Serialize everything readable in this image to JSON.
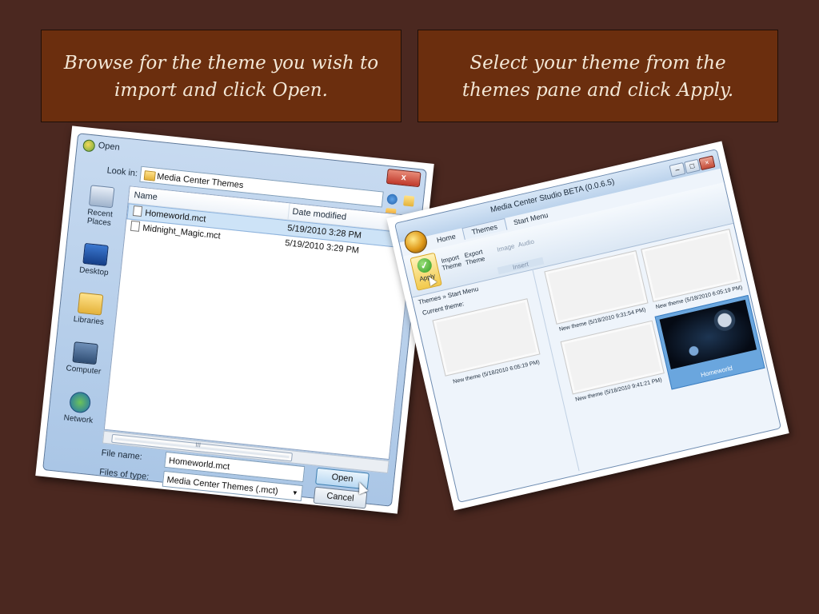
{
  "captions": {
    "left": "Browse for the theme you wish to import and click Open.",
    "right": "Select your theme from the themes pane and click Apply."
  },
  "open_dialog": {
    "title": "Open",
    "close_glyph": "x",
    "look_in_label": "Look in:",
    "look_in_value": "Media Center Themes",
    "places": [
      {
        "label": "Recent Places",
        "icon": "recent-places-icon"
      },
      {
        "label": "Desktop",
        "icon": "desktop-icon"
      },
      {
        "label": "Libraries",
        "icon": "libraries-icon"
      },
      {
        "label": "Computer",
        "icon": "computer-icon"
      },
      {
        "label": "Network",
        "icon": "network-icon"
      }
    ],
    "columns": {
      "name": "Name",
      "date": "Date modified"
    },
    "files": [
      {
        "name": "Homeworld.mct",
        "date": "5/19/2010 3:28 PM",
        "selected": true
      },
      {
        "name": "Midnight_Magic.mct",
        "date": "5/19/2010 3:29 PM",
        "selected": false
      }
    ],
    "scroll_grip": "III",
    "file_name_label": "File name:",
    "file_name_value": "Homeworld.mct",
    "file_type_label": "Files of type:",
    "file_type_value": "Media Center Themes (.mct)",
    "open_button": "Open",
    "cancel_button": "Cancel"
  },
  "studio": {
    "title": "Media Center Studio BETA (0.0.6.5)",
    "tabs": [
      "Home",
      "Themes",
      "Start Menu"
    ],
    "active_tab": "Themes",
    "ribbon": {
      "apply": "Apply",
      "import": "Import Theme",
      "export": "Export Theme",
      "image": "Image",
      "audio": "Audio",
      "group": "Insert"
    },
    "breadcrumb": "Themes  »  Start Menu",
    "current_theme_label": "Current theme:",
    "current_theme_caption": "New theme (5/18/2010 6:05:19 PM)",
    "themes": [
      {
        "caption": "New theme (5/18/2010 9:31:54 PM)"
      },
      {
        "caption": "New theme (5/18/2010 6:05:19 PM)"
      },
      {
        "caption": "New theme (5/18/2010 9:41:21 PM)"
      },
      {
        "caption": "Homeworld",
        "selected": true
      }
    ]
  },
  "colors": {
    "background": "#4b2820",
    "caption_box": "#6b2e0e",
    "caption_text": "#f3e7d6",
    "selection": "#6aa6de"
  }
}
